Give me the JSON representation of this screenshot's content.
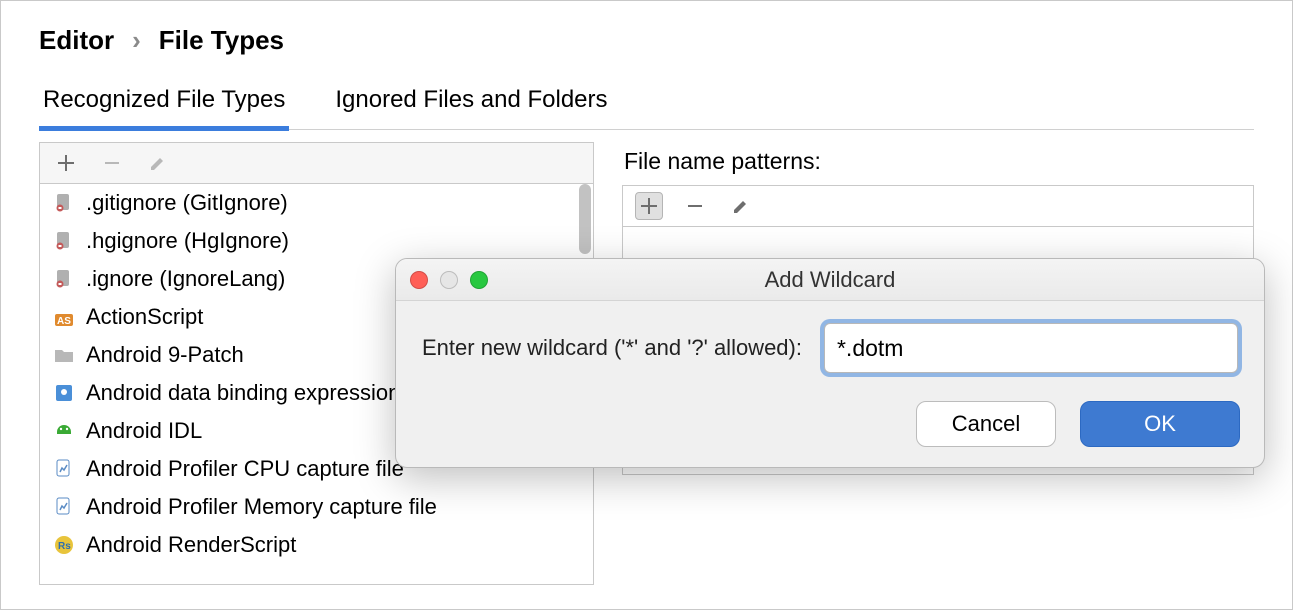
{
  "breadcrumb": {
    "parent": "Editor",
    "current": "File Types"
  },
  "tabs": {
    "recognized": "Recognized File Types",
    "ignored": "Ignored Files and Folders"
  },
  "file_types": [
    ".gitignore (GitIgnore)",
    ".hgignore (HgIgnore)",
    ".ignore (IgnoreLang)",
    "ActionScript",
    "Android 9-Patch",
    "Android data binding expression",
    "Android IDL",
    "Android Profiler CPU capture file",
    "Android Profiler Memory capture file",
    "Android RenderScript"
  ],
  "patterns": {
    "label": "File name patterns:"
  },
  "dialog": {
    "title": "Add Wildcard",
    "prompt": "Enter new wildcard ('*' and '?' allowed):",
    "input_value": "*.dotm",
    "cancel": "Cancel",
    "ok": "OK"
  }
}
